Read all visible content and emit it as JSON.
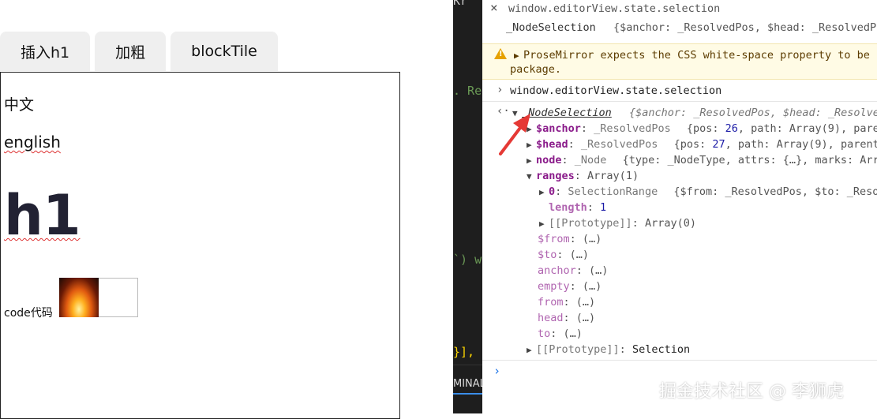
{
  "toolbar": {
    "btn_h1": "插入h1",
    "btn_bold": "加粗",
    "btn_block": "blockTile"
  },
  "editor": {
    "paragraph_zh": "中文",
    "paragraph_en": "english",
    "heading": "h1",
    "code_text": "code代码"
  },
  "strip": {
    "top_text": "Kr",
    "mid_text": ". Re",
    "paren_text": "`) w",
    "bracket_text": "}],",
    "terminal_tab": "MINAL"
  },
  "console": {
    "close_icon": "×",
    "line1_expr": "window.editorView.state.selection",
    "line1_result_class": "_NodeSelection",
    "line1_result_props": "{$anchor: _ResolvedPos, $head: _ResolvedPos",
    "warning_text_1": "ProseMirror expects the CSS white-space property to be s",
    "warning_text_2": "package.",
    "line2_expr": "window.editorView.state.selection",
    "tree": {
      "root_class": "_NodeSelection",
      "root_props": "{$anchor: _ResolvedPos, $head: _Resolved",
      "anchor_key": "$anchor",
      "anchor_class": "_ResolvedPos",
      "anchor_pos": "26",
      "anchor_rest": ", path: Array(9), pare",
      "head_key": "$head",
      "head_class": "_ResolvedPos",
      "head_pos": "27",
      "head_rest": ", path: Array(9), parent(",
      "node_key": "node",
      "node_class": "_Node",
      "node_rest": "{type: _NodeType, attrs: {…}, marks: Arr",
      "ranges_key": "ranges",
      "ranges_val": "Array(1)",
      "range0_key": "0",
      "range0_class": "SelectionRange",
      "range0_rest": "{$from: _ResolvedPos, $to: _Resol",
      "length_key": "length",
      "length_val": "1",
      "proto1": "[[Prototype]]",
      "proto1_val": "Array(0)",
      "getters": [
        "$from",
        "$to",
        "anchor",
        "empty",
        "from",
        "head",
        "to"
      ],
      "getter_val": "(…)",
      "proto2": "[[Prototype]]",
      "proto2_val": "Selection"
    }
  },
  "watermark": "掘金技术社区 @ 李狮虎",
  "colors": {
    "accent_red": "#e53935",
    "warning_bg": "#fffbe5",
    "key_purple": "#8a1b8a",
    "number_blue": "#1a1aa6"
  }
}
